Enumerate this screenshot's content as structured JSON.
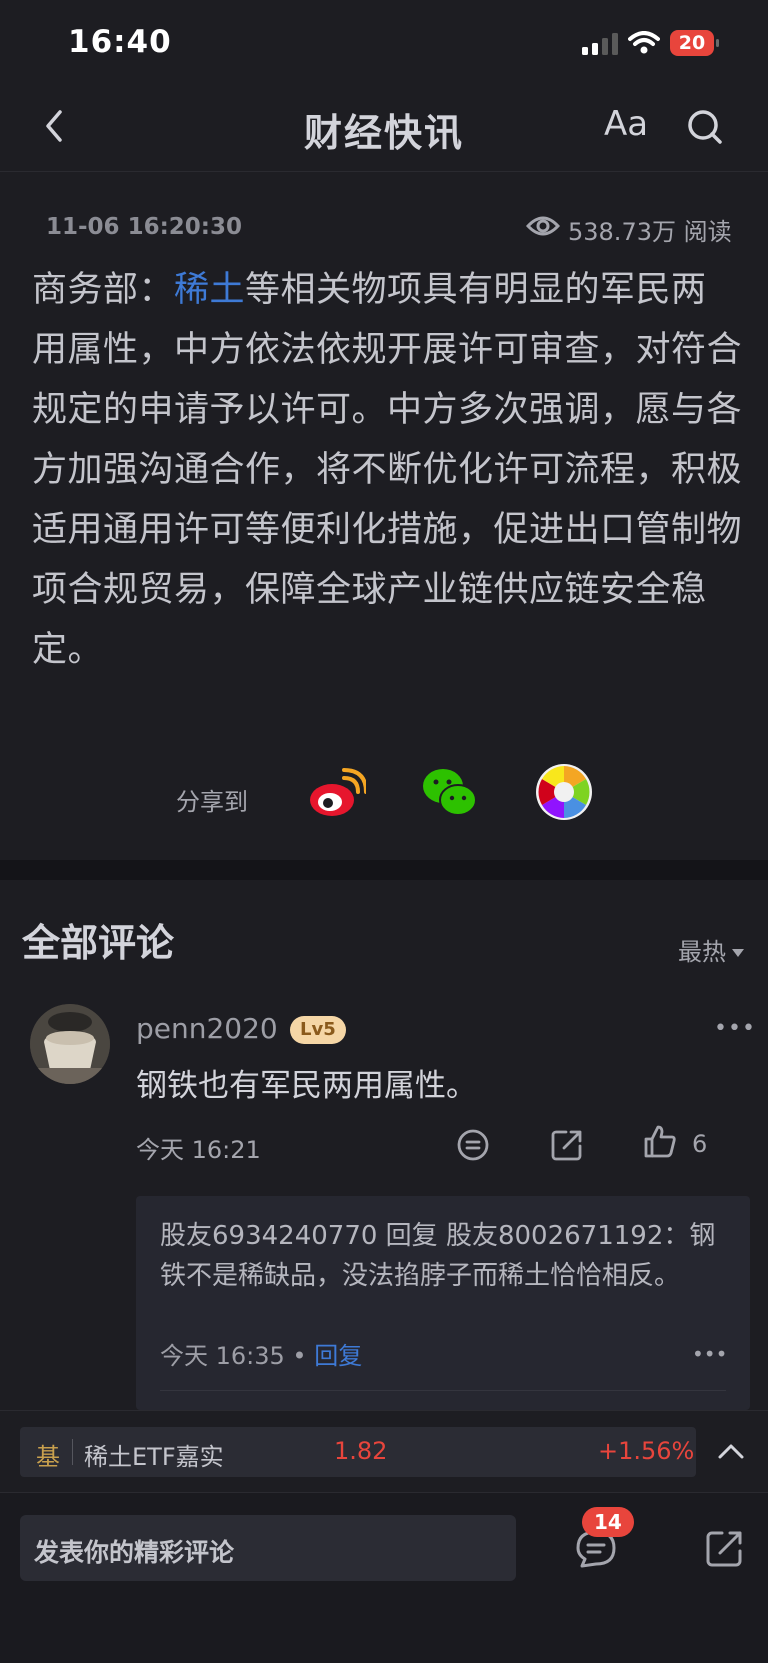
{
  "status_bar": {
    "time": "16:40",
    "battery": "20"
  },
  "nav": {
    "title": "财经快讯",
    "font_button": "Aa"
  },
  "article": {
    "datetime": "11-06 16:20:30",
    "read_count": "538.73万 阅读",
    "body_prefix": "商务部：",
    "body_link": "稀土",
    "body_rest": "等相关物项具有明显的军民两用属性，中方依法依规开展许可审查，对符合规定的申请予以许可。中方多次强调，愿与各方加强沟通合作，将不断优化许可流程，积极适用通用许可等便利化措施，促进出口管制物项合规贸易，保障全球产业链供应链安全稳定。",
    "share_label": "分享到"
  },
  "comments": {
    "title": "全部评论",
    "sort": "最热",
    "items": [
      {
        "username": "penn2020",
        "level": "Lv5",
        "text": "钢铁也有军民两用属性。",
        "time": "今天 16:21",
        "likes": "6",
        "reply": {
          "text": "股友6934240770 回复 股友8002671192：钢铁不是稀缺品，没法掐脖子而稀土恰恰相反。",
          "time": "今天 16:35",
          "sep": " • ",
          "reply_label": "回复"
        }
      }
    ]
  },
  "ticker": {
    "tag": "基",
    "name": "稀土ETF嘉实",
    "price": "1.82",
    "change": "+1.56%",
    "color_down": "#e8453c"
  },
  "bottom_bar": {
    "input_placeholder": "发表你的精彩评论",
    "comment_count": "14"
  },
  "colors": {
    "accent_blue": "#3e7ad6",
    "background": "#1d1d22",
    "red": "#e8453c"
  }
}
